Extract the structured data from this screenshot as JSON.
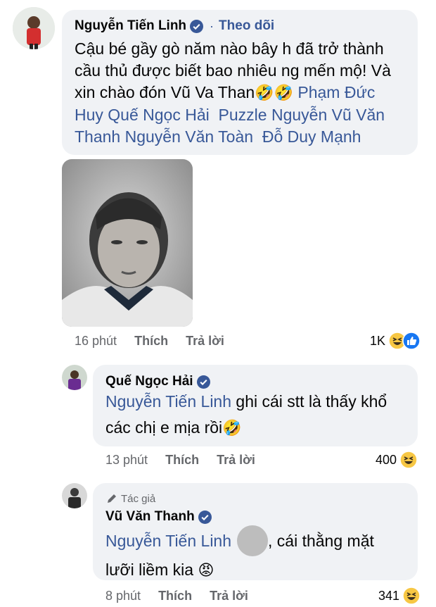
{
  "comment1": {
    "author": "Nguyễn Tiến Linh",
    "separator": "·",
    "follow": "Theo dõi",
    "text_line1": "Cậu bé gầy gò năm nào bây h đã trở thành",
    "text_line2": "cầu thủ được biết bao nhiêu ng mến mộ! Và",
    "text_line3": "xin chào đón Vũ Va Than",
    "laugh_emoji": "🤣🤣",
    "mention1": "Phạm Đức",
    "mention2": "Huy",
    "mention3": "Quế Ngọc Hải",
    "mention4": "Puzzle Nguyễn Vũ Văn",
    "mention5": "Thanh",
    "mention6": "Nguyễn Văn Toàn",
    "mention7": "Đỗ Duy Mạnh",
    "time": "16 phút",
    "like": "Thích",
    "reply": "Trả lời",
    "reaction_count": "1K"
  },
  "comment2": {
    "author": "Quế Ngọc Hải",
    "mention": "Nguyễn Tiến Linh",
    "text_part1": "ghi cái stt là thấy khổ",
    "text_part2": "các chị e mịa rồi",
    "emoji": "🤣",
    "time": "13 phút",
    "like": "Thích",
    "reply": "Trả lời",
    "reaction_count": "400"
  },
  "comment3": {
    "badge": "Tác giả",
    "author": "Vũ Văn Thanh",
    "mention": "Nguyễn Tiến Linh",
    "text_part1": ", cái thằng mặt",
    "text_part2": "lưỡi liềm kia",
    "emoji": "😡",
    "time": "8 phút",
    "like": "Thích",
    "reply": "Trả lời",
    "reaction_count": "341"
  },
  "colors": {
    "accent": "#385898",
    "bubble": "#f0f2f5",
    "meta": "#65676b",
    "verified": "#1877f2"
  }
}
